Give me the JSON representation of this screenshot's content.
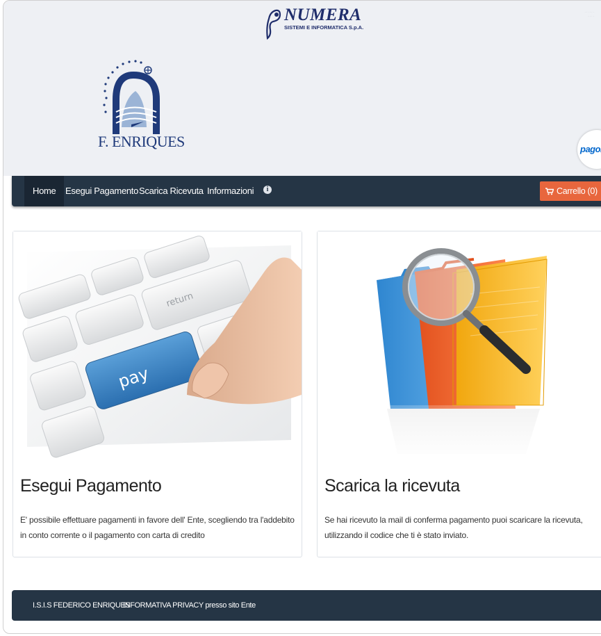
{
  "header": {
    "vendor_name": "NUMERA",
    "vendor_sub": "SISTEMI E INFORMATICA S.p.A.",
    "logo_text": "F. ENRIQUES",
    "pagopa": "pagoPA"
  },
  "nav": {
    "items": [
      {
        "label": "Home"
      },
      {
        "label": "Esegui Pagamento"
      },
      {
        "label": "Scarica Ricevuta"
      },
      {
        "label": "Informazioni"
      }
    ],
    "info_icon": "info-icon",
    "cart_label": "Carrello (0)"
  },
  "cards": [
    {
      "title": "Esegui Pagamento",
      "text": "E' possibile effettuare pagamenti in favore dell' Ente, scegliendo tra l'addebito in conto corrente o il pagamento con carta di credito",
      "image_key_label": "pay",
      "image_return_label": "return"
    },
    {
      "title": "Scarica la ricevuta",
      "text": "Se hai ricevuto la mail di conferma pagamento puoi scaricare la ricevuta, utilizzando il codice che ti è stato inviato."
    }
  ],
  "footer": {
    "links": [
      {
        "label": "I.S.I.S FEDERICO ENRIQUES"
      },
      {
        "label": "INFORMATIVA PRIVACY presso sito Ente"
      }
    ]
  },
  "colors": {
    "navbar": "#253545",
    "cart_button": "#e8663d",
    "header_bg": "#eef0f4",
    "brand": "#1f2d6b"
  }
}
